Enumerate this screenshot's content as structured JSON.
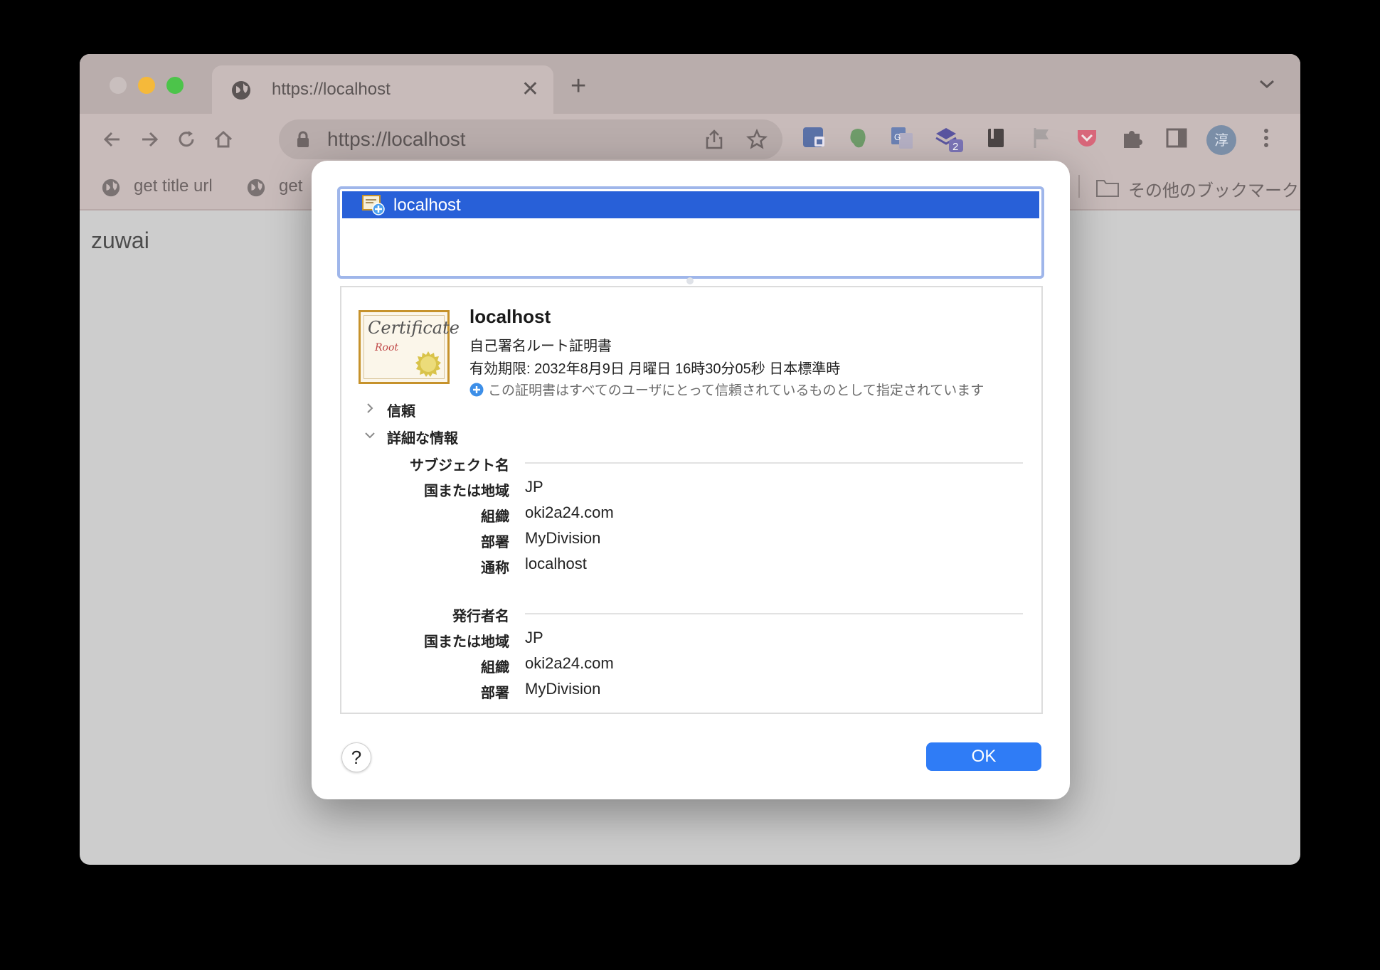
{
  "browser": {
    "tab": {
      "title": "https://localhost"
    },
    "address_bar": {
      "url": "https://localhost"
    },
    "bookmarks": [
      {
        "label": "get title url"
      },
      {
        "label": "get"
      }
    ],
    "other_bookmarks_label": "その他のブックマーク",
    "avatar_letter": "淳",
    "extension_badge_count": "2",
    "page_text": "zuwai"
  },
  "dialog": {
    "cert_list": [
      {
        "label": "localhost",
        "selected": true
      }
    ],
    "certificate": {
      "image_title": "Certificate",
      "image_subtitle": "Root",
      "name": "localhost",
      "kind": "自己署名ルート証明書",
      "expiry": "有効期限: 2032年8月9日 月曜日 16時30分05秒 日本標準時",
      "trust_note": "この証明書はすべてのユーザにとって信頼されているものとして指定されています"
    },
    "sections": {
      "trust_label": "信頼",
      "trust_expanded": false,
      "details_label": "詳細な情報",
      "details_expanded": true
    },
    "subject": {
      "heading": "サブジェクト名",
      "fields": [
        {
          "key": "国または地域",
          "value": "JP"
        },
        {
          "key": "組織",
          "value": "oki2a24.com"
        },
        {
          "key": "部署",
          "value": "MyDivision"
        },
        {
          "key": "通称",
          "value": "localhost"
        }
      ]
    },
    "issuer": {
      "heading": "発行者名",
      "fields": [
        {
          "key": "国または地域",
          "value": "JP"
        },
        {
          "key": "組織",
          "value": "oki2a24.com"
        },
        {
          "key": "部署",
          "value": "MyDivision"
        }
      ]
    },
    "help_label": "?",
    "ok_label": "OK"
  },
  "colors": {
    "selection_blue": "#2860d8",
    "ok_blue": "#2f7cf6",
    "chrome_frame": "#b9adac"
  }
}
